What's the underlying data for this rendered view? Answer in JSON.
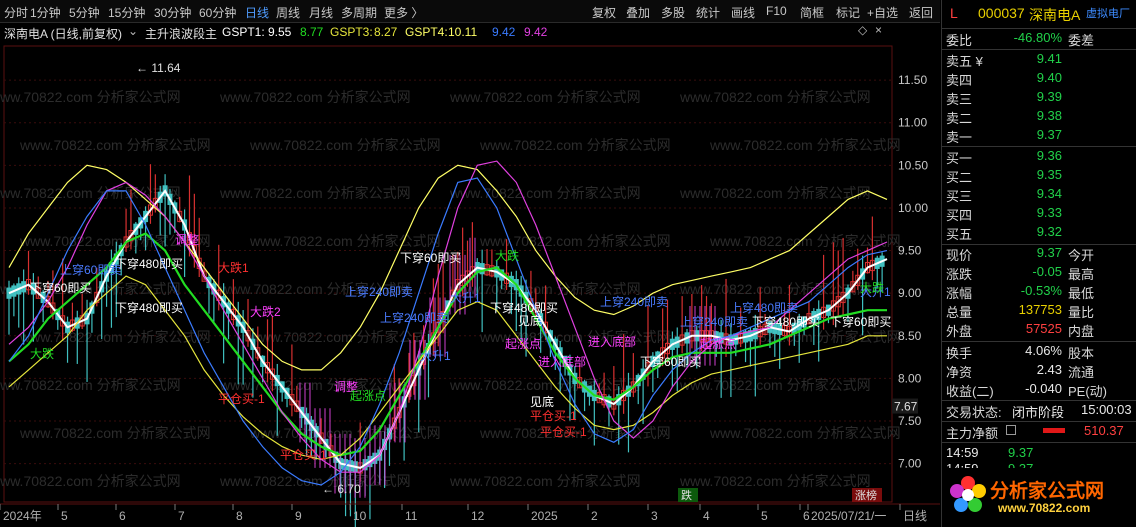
{
  "toolbar": {
    "left_tabs": [
      "分时",
      "1分钟",
      "5分钟",
      "15分钟",
      "30分钟",
      "60分钟",
      "日线",
      "周线",
      "月线",
      "多周期",
      "更多 〉"
    ],
    "active_tab": "日线",
    "right_tabs": [
      "复权",
      "叠加",
      "多股",
      "统计",
      "画线",
      "F10",
      "简框",
      "标记",
      "+自选",
      "返回"
    ]
  },
  "info_line": {
    "stock_title": "深南电A (日线,前复权)",
    "indicator_name": "主升浪波段主",
    "gspt1_label": "GSPT1:",
    "gspt1_value": "9.55",
    "gspt2_value": "8.77",
    "gspt3_label": "GSPT3:",
    "gspt3_value": "8.27",
    "gspt4_label": "GSPT4:",
    "gspt4_value": "10.11",
    "extra1": "9.42",
    "extra2": "9.42"
  },
  "chart_data": {
    "type": "line",
    "price_axis_ticks": [
      "11.50",
      "11.00",
      "10.50",
      "10.00",
      "9.50",
      "9.00",
      "8.50",
      "8.00",
      "7.50",
      "7.00"
    ],
    "ylim": [
      6.55,
      11.9
    ],
    "current_price_tag": "7.67",
    "high_marker": "11.64",
    "low_marker": "6.70",
    "x_labels": [
      "2024年",
      "5",
      "6",
      "7",
      "8",
      "9",
      "10",
      "11",
      "12",
      "2025",
      "2",
      "3",
      "4",
      "5",
      "6",
      "2025/07/21/一",
      "日线"
    ],
    "watermark": "www.70822.com 分析家公式网",
    "bottom_tags": [
      "跌",
      "涨榜"
    ],
    "annotations": {
      "white": [
        "下穿60即买",
        "下穿480即买",
        "下穿480即买",
        "下穿60即买",
        "下穿480即买",
        "下穿60即买",
        "下穿480即买",
        "下穿60即买",
        "见底",
        "见底"
      ],
      "blue": [
        "上穿60即卖",
        "上穿240即卖",
        "上穿240即卖",
        "上穿240即卖",
        "上穿240即卖",
        "上穿480即卖",
        "大升1",
        "大升1",
        "大升1"
      ],
      "magenta": [
        "调整",
        "调整",
        "起涨点",
        "进入底部",
        "进入底部",
        "起涨点",
        "大跌2"
      ],
      "red": [
        "大跌1",
        "平仓买-1",
        "平仓买-1",
        "平仓买-1",
        "平仓买-1"
      ],
      "green": [
        "大跌",
        "大跌",
        "大跌",
        "起涨点"
      ]
    },
    "series": [
      {
        "name": "GSPT1",
        "color": "#ffffff",
        "values": [
          9.0,
          9.1,
          8.9,
          8.6,
          8.7,
          9.2,
          9.6,
          9.9,
          10.2,
          9.8,
          9.2,
          8.9,
          8.6,
          8.2,
          7.9,
          7.6,
          7.3,
          7.0,
          6.95,
          7.1,
          7.6,
          8.1,
          8.6,
          9.1,
          9.3,
          9.25,
          9.1,
          8.8,
          8.4,
          8.0,
          7.8,
          7.7,
          7.9,
          8.2,
          8.4,
          8.5,
          8.5,
          8.45,
          8.5,
          8.6,
          8.55,
          8.7,
          8.8,
          9.0,
          9.3,
          9.4
        ]
      },
      {
        "name": "GSPT2",
        "color": "#22dd22",
        "values": [
          8.2,
          8.4,
          8.7,
          8.9,
          9.1,
          9.3,
          9.6,
          9.7,
          9.5,
          9.1,
          8.8,
          8.5,
          8.2,
          7.9,
          7.6,
          7.35,
          7.2,
          7.1,
          7.15,
          7.4,
          7.8,
          8.2,
          8.6,
          9.0,
          9.25,
          9.3,
          9.1,
          8.7,
          8.3,
          8.0,
          7.8,
          7.75,
          7.9,
          8.1,
          8.25,
          8.3,
          8.3,
          8.3,
          8.35,
          8.4,
          8.5,
          8.6,
          8.7,
          8.75,
          8.8,
          8.8
        ]
      },
      {
        "name": "GSPT3",
        "color": "#e6e63c",
        "values": [
          7.9,
          8.1,
          8.3,
          8.5,
          8.8,
          9.0,
          9.2,
          9.1,
          8.8,
          8.5,
          8.1,
          7.8,
          7.55,
          7.35,
          7.2,
          7.1,
          7.05,
          7.1,
          7.3,
          7.6,
          7.9,
          8.2,
          8.5,
          8.8,
          8.9,
          8.8,
          8.5,
          8.2,
          7.9,
          7.65,
          7.45,
          7.4,
          7.45,
          7.6,
          7.8,
          7.95,
          8.05,
          8.1,
          8.15,
          8.2,
          8.25,
          8.3,
          8.35,
          8.4,
          8.5,
          8.5
        ]
      },
      {
        "name": "GSPT4",
        "color": "#ffff66",
        "values": [
          9.3,
          9.7,
          10.0,
          10.3,
          10.5,
          10.45,
          10.3,
          10.1,
          9.9,
          9.6,
          9.3,
          9.0,
          8.7,
          8.4,
          8.2,
          8.1,
          8.1,
          8.3,
          8.6,
          9.0,
          9.5,
          10.0,
          10.35,
          10.5,
          10.45,
          10.2,
          9.9,
          9.5,
          9.2,
          8.95,
          8.8,
          8.75,
          8.85,
          9.0,
          9.1,
          9.15,
          9.2,
          9.25,
          9.3,
          9.4,
          9.5,
          9.7,
          9.9,
          10.1,
          10.2,
          10.1
        ]
      },
      {
        "name": "MA-magenta",
        "color": "#e040e0",
        "values": [
          8.4,
          8.6,
          8.9,
          9.3,
          9.8,
          10.2,
          10.3,
          10.15,
          9.9,
          9.6,
          9.2,
          8.8,
          8.4,
          8.0,
          7.6,
          7.3,
          7.05,
          6.9,
          6.9,
          7.1,
          7.6,
          8.3,
          9.2,
          10.0,
          10.5,
          10.55,
          10.3,
          9.8,
          9.2,
          8.6,
          8.0,
          7.5,
          7.3,
          7.5,
          7.9,
          8.2,
          8.4,
          8.5,
          8.55,
          8.6,
          8.8,
          9.0,
          9.2,
          9.4,
          9.5,
          9.6
        ]
      },
      {
        "name": "MA-blue",
        "color": "#3a7bff",
        "values": [
          8.2,
          8.5,
          9.0,
          9.5,
          9.9,
          10.2,
          10.2,
          9.8,
          9.3,
          8.8,
          8.3,
          7.9,
          7.5,
          7.2,
          6.95,
          6.8,
          6.75,
          6.9,
          7.2,
          7.7,
          8.3,
          9.0,
          9.7,
          10.3,
          10.35,
          10.0,
          9.4,
          8.8,
          8.2,
          7.7,
          7.35,
          7.25,
          7.4,
          7.8,
          8.1,
          8.3,
          8.45,
          8.5,
          8.6,
          8.7,
          8.8,
          8.9,
          9.1,
          9.3,
          9.45,
          9.5
        ]
      }
    ]
  },
  "panel": {
    "header": {
      "market": "L",
      "code": "000037",
      "name": "深南电A",
      "tag": "虚拟电厂"
    },
    "ratio": {
      "label1": "委比",
      "value1": "-46.80%",
      "label2": "委差"
    },
    "asks": [
      {
        "label": "卖五 ¥",
        "price": "9.41"
      },
      {
        "label": "卖四",
        "price": "9.40"
      },
      {
        "label": "卖三",
        "price": "9.39"
      },
      {
        "label": "卖二",
        "price": "9.38"
      },
      {
        "label": "卖一",
        "price": "9.37"
      }
    ],
    "bids": [
      {
        "label": "买一",
        "price": "9.36"
      },
      {
        "label": "买二",
        "price": "9.35"
      },
      {
        "label": "买三",
        "price": "9.34"
      },
      {
        "label": "买四",
        "price": "9.33"
      },
      {
        "label": "买五",
        "price": "9.32"
      }
    ],
    "quote": [
      {
        "l": "现价",
        "v": "9.37",
        "c": "green",
        "r": "今开"
      },
      {
        "l": "涨跌",
        "v": "-0.05",
        "c": "green",
        "r": "最高"
      },
      {
        "l": "涨幅",
        "v": "-0.53%",
        "c": "green",
        "r": "最低"
      },
      {
        "l": "总量",
        "v": "137753",
        "c": "yellow",
        "r": "量比"
      },
      {
        "l": "外盘",
        "v": "57525",
        "c": "red",
        "r": "内盘"
      }
    ],
    "fin": [
      {
        "l": "换手",
        "v": "4.06%",
        "r": "股本"
      },
      {
        "l": "净资",
        "v": "2.43",
        "r": "流通"
      },
      {
        "l": "收益(二)",
        "v": "-0.040",
        "r": "PE(动)"
      }
    ],
    "status": {
      "label": "交易状态:",
      "value": "闭市阶段",
      "time": "15:00:03"
    },
    "netflow": {
      "label": "主力净额",
      "value": "510.37"
    },
    "ticks": [
      {
        "t": "14:59",
        "p": "9.37"
      },
      {
        "t": "14:59",
        "p": "9.37"
      }
    ],
    "logo": {
      "text": "分析家公式网",
      "url": "www.70822.com"
    }
  }
}
